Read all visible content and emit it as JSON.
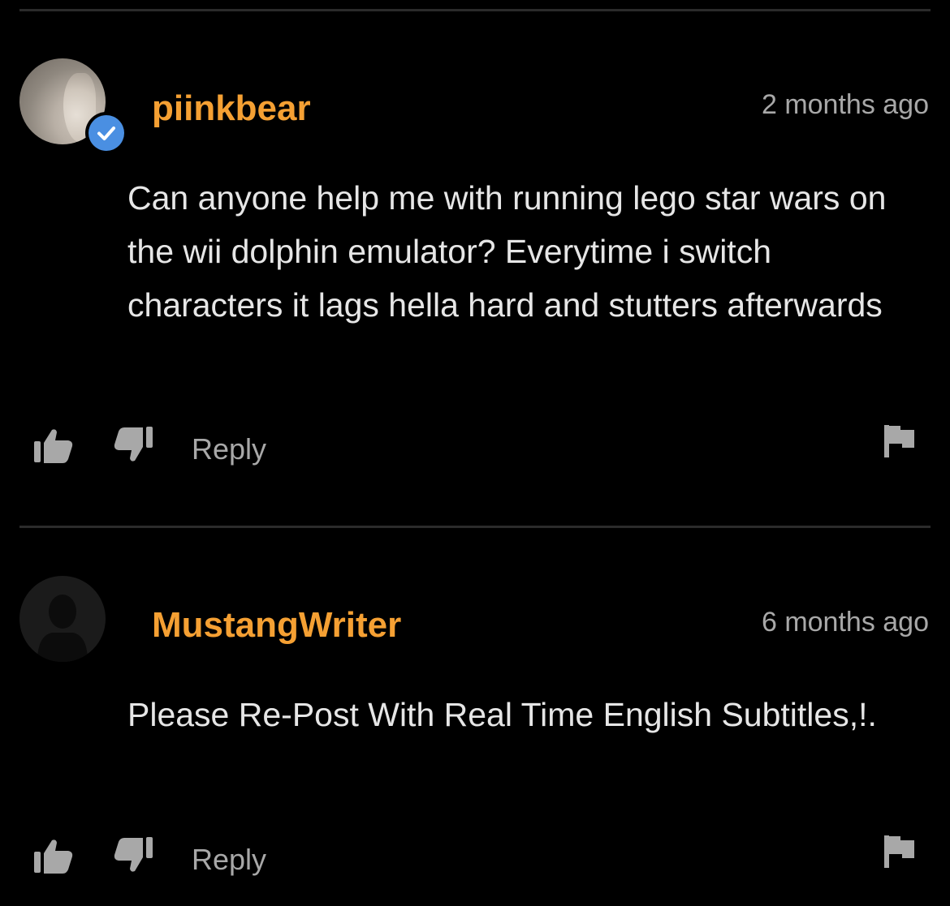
{
  "comments": [
    {
      "username": "piinkbear",
      "timestamp": "2 months ago",
      "verified": true,
      "avatar": "photo-avatar",
      "body": "Can anyone help me with running lego star wars on the wii dolphin emulator? Everytime i switch characters it lags hella hard and stutters afterwards",
      "reply_label": "Reply",
      "icons": [
        "thumbs-up-icon",
        "thumbs-down-icon",
        "flag-icon",
        "verified-check-icon"
      ]
    },
    {
      "username": "MustangWriter",
      "timestamp": "6 months ago",
      "verified": false,
      "avatar": "default-user-avatar",
      "body": "Please Re-Post With Real Time English Subtitles,!.",
      "reply_label": "Reply",
      "icons": [
        "thumbs-up-icon",
        "thumbs-down-icon",
        "flag-icon"
      ]
    }
  ],
  "colors": {
    "background": "#000000",
    "username": "#f5a033",
    "timestamp": "#a8a8a8",
    "body_text": "#e6e6e6",
    "divider": "#2b2b2b",
    "verified_badge": "#4a8fe2",
    "icon": "#a8a8a8"
  }
}
